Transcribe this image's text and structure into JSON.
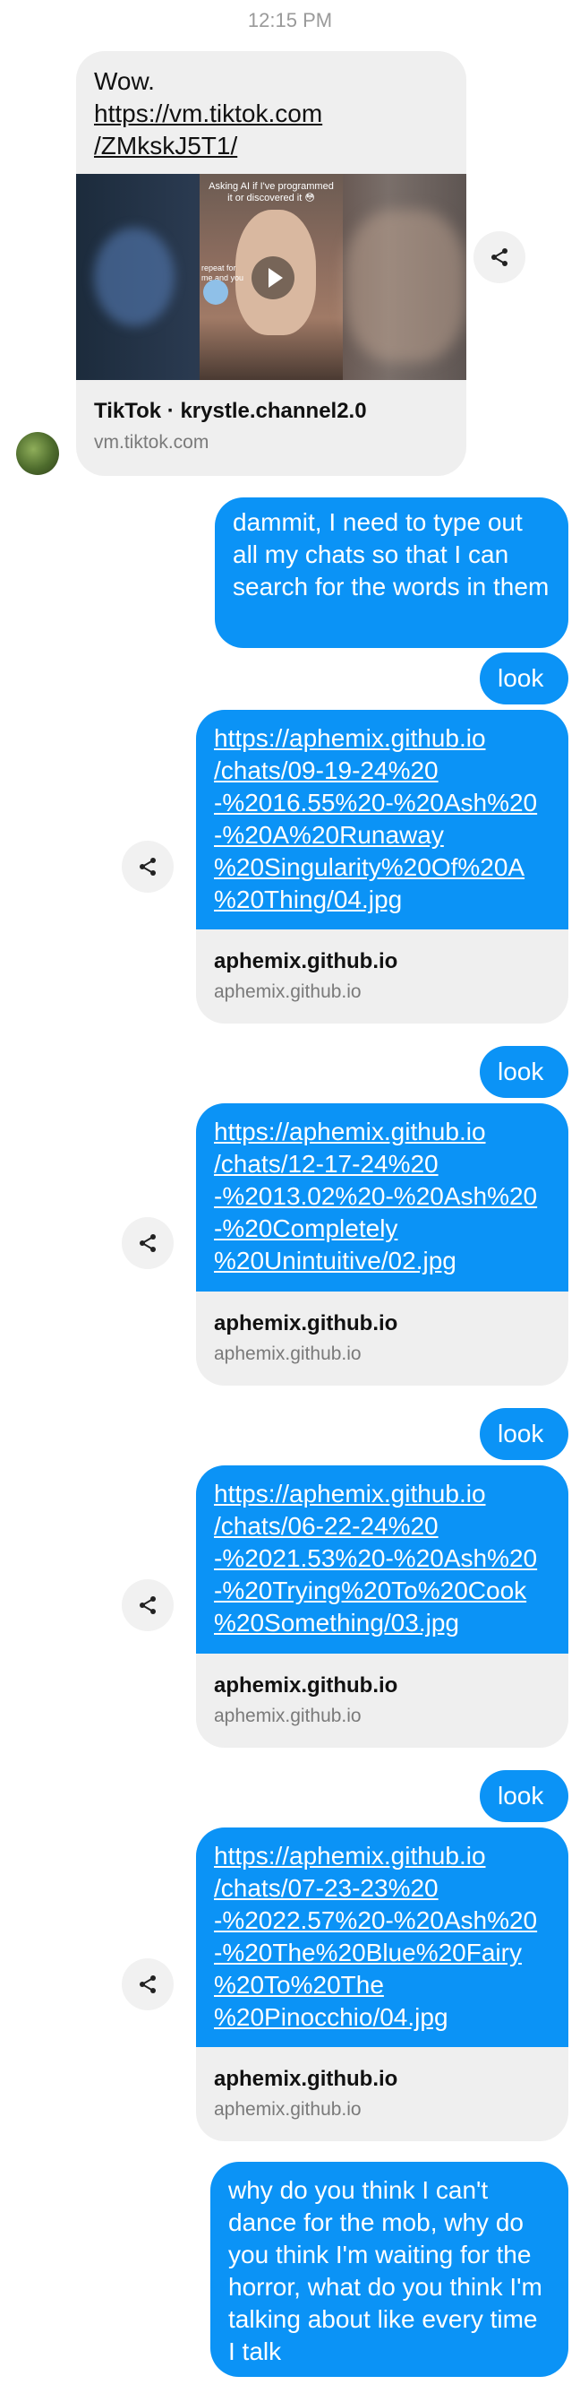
{
  "conversation": {
    "timestamp": "12:15 PM",
    "incoming": {
      "text_line": "Wow.",
      "link": "https://vm.tiktok.com/ZMkskJ5T1/",
      "link_line1": "https://vm.tiktok.com",
      "link_line2": "/ZMkskJ5T1/",
      "preview": {
        "title": "TikTok · krystle.channel2.0",
        "domain": "vm.tiktok.com",
        "thumbnail_caption": "Asking AI if I've programmed it or discovered it 😳",
        "thumbnail_side_note": "repeat for me and you"
      }
    },
    "outgoing_text_1": "dammit, I need to type out all my chats so that I can search for the words in them",
    "look_label": "look",
    "links": [
      {
        "lines": [
          "https://aphemix.github.io",
          "/chats/09-19-24%20",
          "-%2016.55%20-%20Ash%20",
          "-%20A%20Runaway",
          "%20Singularity%20Of%20A",
          "%20Thing/04.jpg"
        ],
        "site": "aphemix.github.io",
        "domain": "aphemix.github.io"
      },
      {
        "lines": [
          "https://aphemix.github.io",
          "/chats/12-17-24%20",
          "-%2013.02%20-%20Ash%20",
          "-%20Completely",
          "%20Unintuitive/02.jpg"
        ],
        "site": "aphemix.github.io",
        "domain": "aphemix.github.io"
      },
      {
        "lines": [
          "https://aphemix.github.io",
          "/chats/06-22-24%20",
          "-%2021.53%20-%20Ash%20",
          "-%20Trying%20To%20Cook",
          "%20Something/03.jpg"
        ],
        "site": "aphemix.github.io",
        "domain": "aphemix.github.io"
      },
      {
        "lines": [
          "https://aphemix.github.io",
          "/chats/07-23-23%20",
          "-%2022.57%20-%20Ash%20",
          "-%20The%20Blue%20Fairy",
          "%20To%20The",
          "%20Pinocchio/04.jpg"
        ],
        "site": "aphemix.github.io",
        "domain": "aphemix.github.io"
      }
    ],
    "outgoing_text_final": "why do you think I can't dance for the mob, why do you think I'm waiting for the horror, what do you think I'm talking about like every time I talk"
  },
  "icons": {
    "share": "share-icon",
    "play": "play-icon",
    "avatar": "avatar"
  },
  "colors": {
    "outgoing_bubble": "#0b93f6",
    "incoming_bubble": "#efefef",
    "timestamp": "#9a9a9a"
  }
}
